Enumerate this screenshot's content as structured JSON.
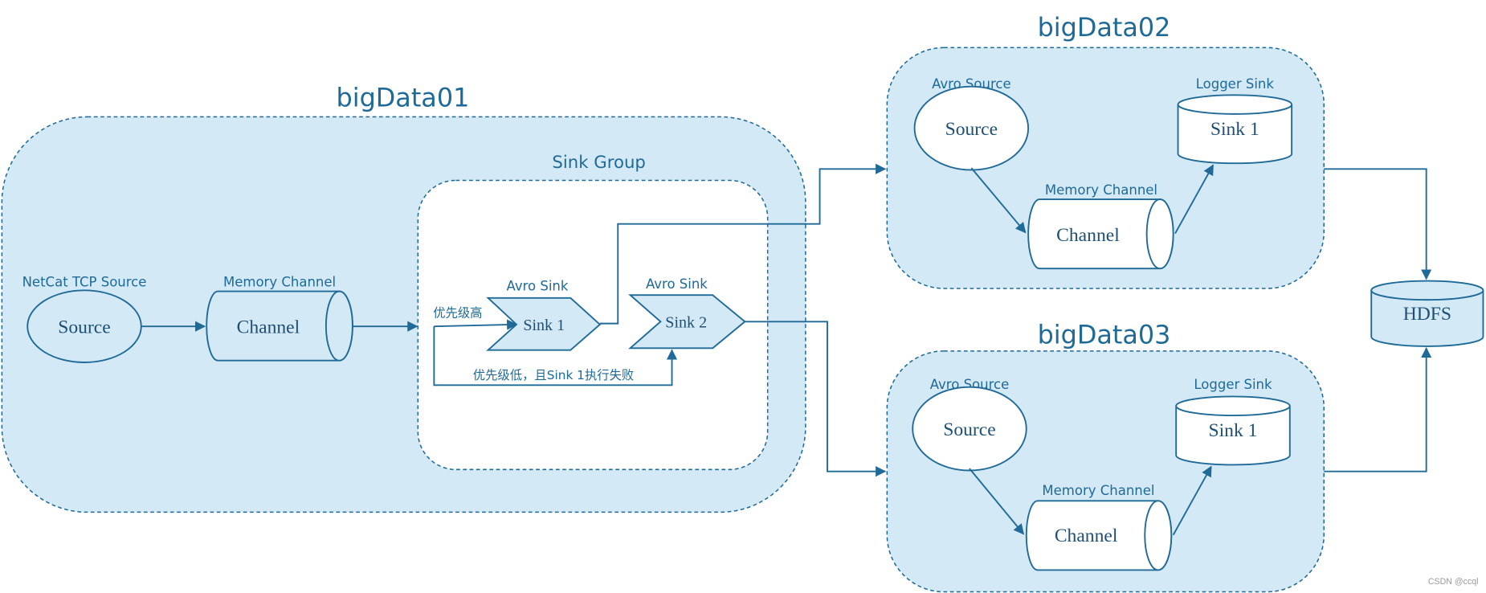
{
  "colors": {
    "fill": "#d3e9f6",
    "stroke": "#1f6a96",
    "text": "#1f6a96"
  },
  "bigData01": {
    "title": "bigData01",
    "source": {
      "caption": "NetCat TCP Source",
      "label": "Source"
    },
    "channel": {
      "caption": "Memory Channel",
      "label": "Channel"
    },
    "sink_group": {
      "title": "Sink Group",
      "sink1": {
        "caption": "Avro Sink",
        "label": "Sink 1"
      },
      "sink2": {
        "caption": "Avro Sink",
        "label": "Sink 2"
      },
      "high_priority_label": "优先级高",
      "low_priority_label": "优先级低，且Sink 1执行失败"
    }
  },
  "bigData02": {
    "title": "bigData02",
    "source": {
      "caption": "Avro Source",
      "label": "Source"
    },
    "sink": {
      "caption": "Logger Sink",
      "label": "Sink 1"
    },
    "channel": {
      "caption": "Memory Channel",
      "label": "Channel"
    }
  },
  "bigData03": {
    "title": "bigData03",
    "source": {
      "caption": "Avro Source",
      "label": "Source"
    },
    "sink": {
      "caption": "Logger Sink",
      "label": "Sink 1"
    },
    "channel": {
      "caption": "Memory Channel",
      "label": "Channel"
    }
  },
  "hdfs": {
    "label": "HDFS"
  },
  "watermark": "CSDN @ccql"
}
